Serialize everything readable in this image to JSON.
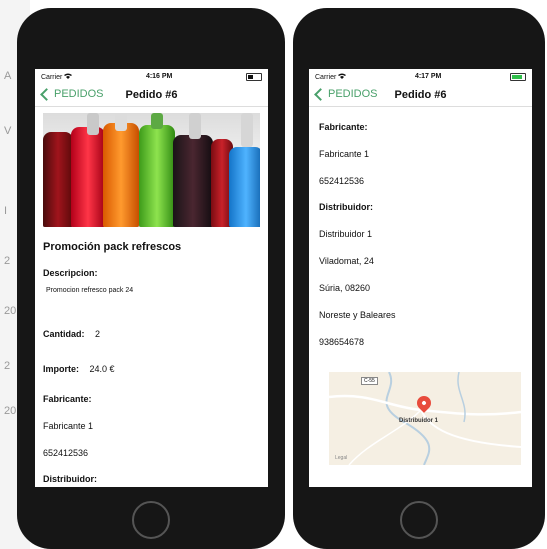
{
  "backdrop_fragments": [
    "A",
    "V",
    "I",
    "2",
    "20",
    "2",
    "20"
  ],
  "screen_left": {
    "status": {
      "carrier": "Carrier",
      "time": "4:16 PM"
    },
    "nav": {
      "back_label": "PEDIDOS",
      "title": "Pedido #6"
    },
    "product_title": "Promoción pack refrescos",
    "descripcion_label": "Descripcion:",
    "descripcion_value": "Promocion refresco pack 24",
    "cantidad_label": "Cantidad:",
    "cantidad_value": "2",
    "importe_label": "Importe:",
    "importe_value": "24.0 €",
    "fabricante_label": "Fabricante:",
    "fabricante_name": "Fabricante 1",
    "fabricante_phone": "652412536",
    "distribuidor_label": "Distribuidor:"
  },
  "screen_right": {
    "status": {
      "carrier": "Carrier",
      "time": "4:17 PM"
    },
    "nav": {
      "back_label": "PEDIDOS",
      "title": "Pedido #6"
    },
    "fabricante_label": "Fabricante:",
    "fabricante_name": "Fabricante 1",
    "fabricante_phone": "652412536",
    "distribuidor_label": "Distribuidor:",
    "distribuidor_name": "Distribuidor 1",
    "distribuidor_address": "Viladomat, 24",
    "distribuidor_city": "Súria, 08260",
    "distribuidor_region": "Noreste y Baleares",
    "distribuidor_phone": "938654678",
    "map": {
      "road_badge": "C-55",
      "pin_label": "Distribuidor 1",
      "legal": "Legal"
    }
  },
  "colors": {
    "accent": "#49a06a",
    "pin": "#e84b3c",
    "phone_body": "#161616"
  },
  "icons": [
    "chevron-left-icon",
    "wifi-icon",
    "battery-icon",
    "map-pin-icon"
  ]
}
